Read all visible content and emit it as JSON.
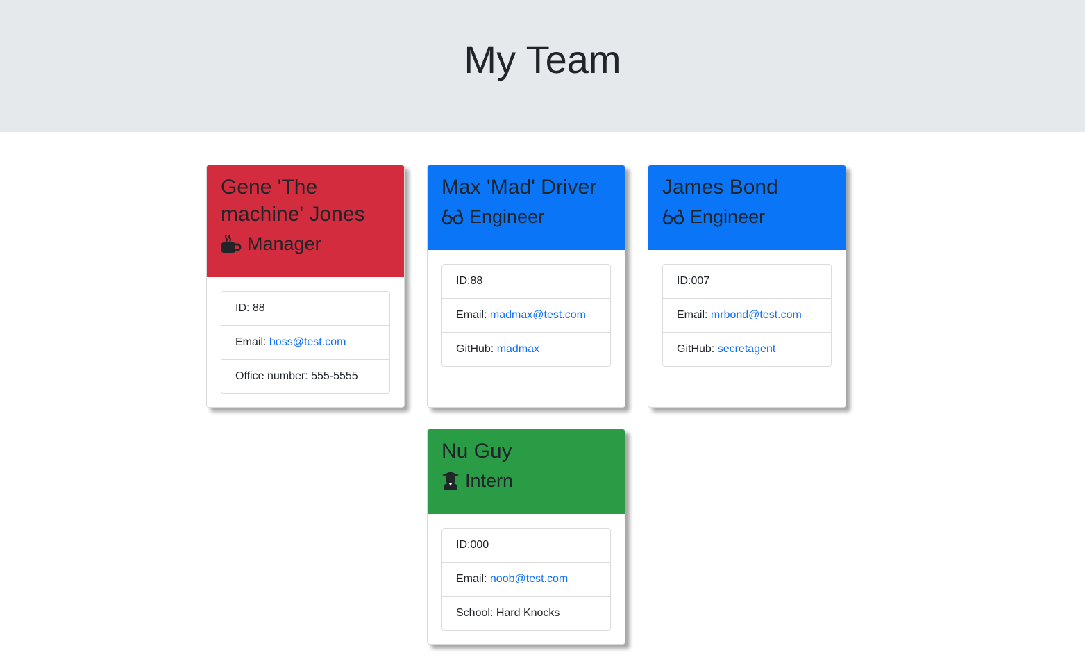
{
  "header": {
    "title": "My Team"
  },
  "colors": {
    "manager": "#d42c3f",
    "engineer": "#0a75f7",
    "intern": "#2b9c46",
    "link": "#0d6efd",
    "jumbotron": "#e5e9ec"
  },
  "cards": [
    {
      "name": "Gene 'The machine' Jones",
      "role": "Manager",
      "icon": "coffee-mug-icon",
      "id_label": "ID: 88",
      "email_label": "Email: ",
      "email": "boss@test.com",
      "extra_label": "Office number: 555-5555"
    },
    {
      "name": "Max 'Mad' Driver",
      "role": "Engineer",
      "icon": "glasses-icon",
      "id_label": "ID:88",
      "email_label": "Email: ",
      "email": "madmax@test.com",
      "extra_label": "GitHub: ",
      "extra_link": "madmax"
    },
    {
      "name": "James Bond",
      "role": "Engineer",
      "icon": "glasses-icon",
      "id_label": "ID:007",
      "email_label": "Email: ",
      "email": "mrbond@test.com",
      "extra_label": "GitHub: ",
      "extra_link": "secretagent"
    },
    {
      "name": "Nu Guy",
      "role": "Intern",
      "icon": "graduate-icon",
      "id_label": "ID:000",
      "email_label": "Email: ",
      "email": "noob@test.com",
      "extra_label": "School: Hard Knocks"
    }
  ]
}
